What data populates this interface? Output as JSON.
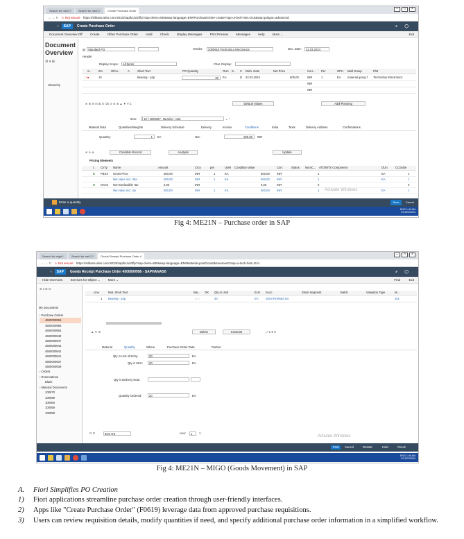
{
  "fig1": {
    "tabs": [
      "Search for me01?",
      "Search for me21?",
      "Create Purchase Order"
    ],
    "address": {
      "nav": "← → ↻",
      "not_secure": "⚠ Not secure",
      "url": "https://silhana.ides.com:8033/sap/bc/ui2/flp?sap-client=800&sap-language=EN#PurchaseOrder-create?sap-ui-tech-hint=GUI&sap-guitype=advanced"
    },
    "shell_title": "Create Purchase Order",
    "toolbar": [
      "Document Overview Off",
      "Create",
      "Other Purchase Order",
      "Hold",
      "Check",
      "Display Messages",
      "Print Preview",
      "Messages",
      "Help",
      "More ⌄"
    ],
    "toolbar_right": [
      "Exit"
    ],
    "doc_overview": "Document Overview",
    "po_type": "Standard PO",
    "vendor_label": "Vendor:",
    "vendor_value": "2000916 Technofour Electronics",
    "doc_date_label": "Doc. Date:",
    "doc_date_value": "22.03.2024",
    "header_label": "Header",
    "display_scope_label": "Display Scope:",
    "display_scope_value": "All Items",
    "char_display_label": "Char. Display:",
    "hierarchy": "Hierarchy",
    "item_headers": [
      "S..",
      "Itm",
      "Gl/co..",
      "A",
      "Short Text",
      "PO Quantity",
      "OUn",
      "S..",
      "C",
      "Deliv. Date",
      "Net Price",
      "Curr...",
      "Per",
      "OPU",
      "Matl Group",
      "Plnt"
    ],
    "item_row": {
      "itm": "10",
      "short_text": "Bearing - p2p",
      "qty": "20",
      "oun": "EA",
      "c": "D",
      "date": "22.03.2024",
      "net_price": "500,00",
      "curr": "INR",
      "per": "1",
      "opu": "EA",
      "matl_group": "material group f",
      "plant": "Technofour Electronics"
    },
    "extra_curr": [
      "INR",
      "INR"
    ],
    "default_values": "Default Values",
    "addl_planning": "Addl Planning",
    "item_label": "Item:",
    "item_value": "[ 10 ] 1000327 , Bearing - p2p",
    "detail_tabs": [
      "Material Data",
      "Quantities/Weights",
      "Delivery Schedule",
      "Delivery",
      "Invoice",
      "Conditions",
      "India",
      "Texts",
      "Delivery Address",
      "Confirmations"
    ],
    "quantity_label": "Quantity:",
    "quantity_value": "1",
    "quantity_unit": "EA",
    "net_label": "Net:",
    "net_value": "500,00",
    "net_curr": "INR",
    "condition_record": "Condition Record",
    "analysis": "Analysis",
    "update": "Update",
    "pricing_title": "Pricing Elements",
    "pricing_headers": [
      "I..",
      "CnTy",
      "Name",
      "Amount",
      "Crcy",
      "per",
      "UoM",
      "Condition Value",
      "Curr.",
      "Status",
      "NumC...",
      "ATO/MTS Component",
      "OUn",
      "CConDe"
    ],
    "pricing_rows": [
      {
        "cnty": "PBXX",
        "name": "Gross Price",
        "amount": "500,00",
        "crcy": "INR",
        "per": "1",
        "uom": "EA",
        "value": "500,00",
        "curr": "INR",
        "num": "1",
        "oun": "EA",
        "cc": "1"
      },
      {
        "cnty": "",
        "name": "Net value incl. disc",
        "amount": "500,00",
        "crcy": "INR",
        "per": "1",
        "uom": "EA",
        "value": "500,00",
        "curr": "INR",
        "num": "1",
        "oun": "EA",
        "cc": "1"
      },
      {
        "cnty": "NAVS",
        "name": "Non-Deductible Tax",
        "amount": "0,00",
        "crcy": "INR",
        "per": "",
        "uom": "",
        "value": "0,00",
        "curr": "INR",
        "num": "0",
        "oun": "",
        "cc": "0"
      },
      {
        "cnty": "",
        "name": "Net value incl. tax",
        "amount": "500,00",
        "crcy": "INR",
        "per": "1",
        "uom": "EA",
        "value": "500,00",
        "curr": "INR",
        "num": "1",
        "oun": "EA",
        "cc": "1"
      }
    ],
    "watermark": "Activate Windows",
    "status_text": "Enter a quantity",
    "save": "Save",
    "cancel": "Cancel",
    "tray": [
      "ENG",
      "IN",
      "1:40 AM",
      "3/22/2024"
    ]
  },
  "caption1": "Fig 4: ME21N – Purchase order in SAP",
  "fig2": {
    "tabs": [
      "Search for migo?",
      "Search for me21?",
      "Goods Receipt Purchase Order 4"
    ],
    "address": {
      "nav": "← → ↻",
      "not_secure": "⚠ Not secure",
      "url": "https://silhana.ides.com:8033/sap/bc/ui2/flp?sap-client=800&sap-language=EN#Material-postGoodsMovement?sap-ui-tech-hint=GUI"
    },
    "shell_title": "Goods Receipt Purchase Order 4500000956 - SAPHANAS0",
    "toolbar": [
      "Hide Overview",
      "Services for Object ⌄",
      "More ⌄"
    ],
    "toolbar_right": [
      "Find",
      "Exit"
    ],
    "my_documents": "My Documents",
    "tree": [
      "Purchase Orders",
      "4500000956",
      "4500000955",
      "4500000954",
      "4500000948",
      "4500000947",
      "4500000944",
      "4500000942",
      "4500000941",
      "4500000937",
      "4500000939",
      "Orders",
      "Reservations",
      "Blank",
      "Material Documents",
      "100070",
      "100069",
      "100060",
      "100059",
      "100058"
    ],
    "line_headers": [
      "Line",
      "Mat. Short Text",
      "Wa...",
      "OK",
      "Qty in UnE",
      "EUn",
      "SLoc",
      "Stock Segment",
      "Batch",
      "Valuation Type",
      "M..."
    ],
    "line_row": {
      "line": "1",
      "text": "Bearing - p2p",
      "qty": "20",
      "eun": "EA",
      "sloc": "Semi Finished Go",
      "m": "101"
    },
    "delete": "Delete",
    "contents": "Contents",
    "detail_tabs": [
      "Material",
      "Quantity",
      "Where",
      "Purchase Order Data",
      "Partner"
    ],
    "qty_entry_label": "Qty in Unit of Entry:",
    "qty_entry_value": "20",
    "qty_entry_unit": "EA",
    "qty_sku_label": "Qty in SKU:",
    "qty_sku_value": "20",
    "qty_sku_unit": "EA",
    "qty_note_label": "Qty in Delivery Note:",
    "qty_ordered_label": "Quantity Ordered:",
    "qty_ordered_value": "20",
    "qty_ordered_unit": "EA",
    "item_ok": "Item OK",
    "line_label": "Line:",
    "line_value": "1",
    "line_of": "1",
    "watermark": "Activate Windows",
    "footer_buttons": [
      "Post",
      "Cancel",
      "Restart",
      "Hold",
      "Check"
    ],
    "tray": [
      "ENG",
      "IN",
      "1:46 AM",
      "3/22/2024"
    ]
  },
  "caption2": "Fig 4: ME21N – MIGO (Goods Movement) in SAP",
  "section": {
    "heading_marker": "A.",
    "heading": "Fiori Simplifies PO Creation",
    "items": [
      {
        "marker": "1)",
        "text": "Fiori applications streamline purchase order creation through user-friendly interfaces."
      },
      {
        "marker": "2)",
        "text": "Apps like \"Create Purchase Order\" (F0619) leverage data from approved purchase requisitions."
      },
      {
        "marker": "3)",
        "text": "Users can review requisition details, modify quantities if need, and specify additional purchase order information in a simplified workflow."
      }
    ]
  }
}
